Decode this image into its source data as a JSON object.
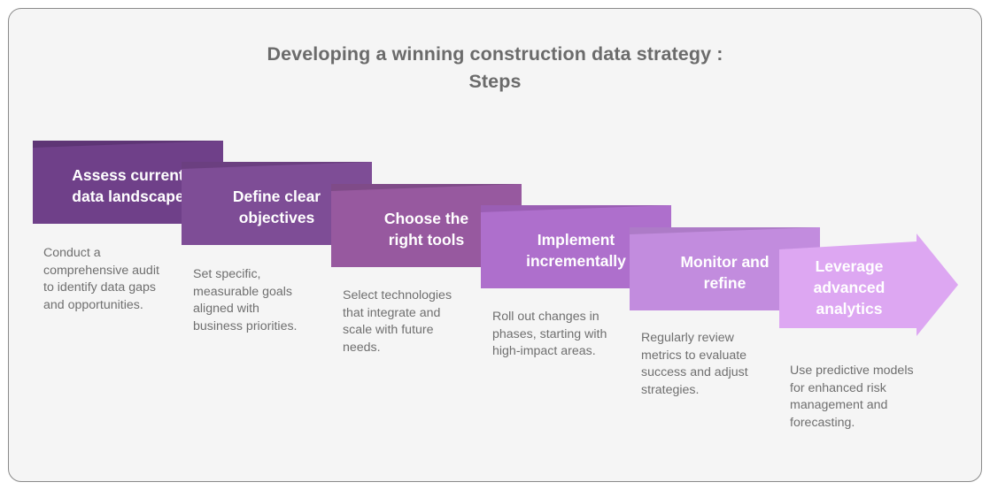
{
  "page": {
    "background_color": "#ffffff",
    "panel_background": "#f5f5f5",
    "panel_border_color": "#8a8a8a"
  },
  "header": {
    "title": "Developing a winning construction data strategy :\nSteps",
    "title_color": "#6b6b6b"
  },
  "diagram": {
    "type": "chevron-process-arrow",
    "step_count": 6,
    "description_color": "#6f6f6f",
    "label_color": "#ffffff",
    "steps": [
      {
        "index": 1,
        "label": "Assess current\ndata landscape",
        "description": "Conduct a\ncomprehensive audit\nto identify data gaps\nand opportunities.",
        "color": "#6f4089"
      },
      {
        "index": 2,
        "label": "Define clear\nobjectives",
        "description": "Set specific,\nmeasurable goals\naligned with\nbusiness priorities.",
        "color": "#7e4d96"
      },
      {
        "index": 3,
        "label": "Choose the\nright tools",
        "description": "Select technologies\nthat integrate and\nscale with future\nneeds.",
        "color": "#97599f"
      },
      {
        "index": 4,
        "label": "Implement\nincrementally",
        "description": "Roll out changes in\nphases, starting with\nhigh-impact areas.",
        "color": "#ae6fcc"
      },
      {
        "index": 5,
        "label": "Monitor and\nrefine",
        "description": "Regularly review\nmetrics to evaluate\nsuccess and adjust\nstrategies.",
        "color": "#c28cde"
      },
      {
        "index": 6,
        "label": "Leverage\nadvanced\nanalytics",
        "description": "Use predictive models\nfor enhanced risk\nmanagement and\nforecasting.",
        "color": "#dda7f2"
      }
    ]
  }
}
